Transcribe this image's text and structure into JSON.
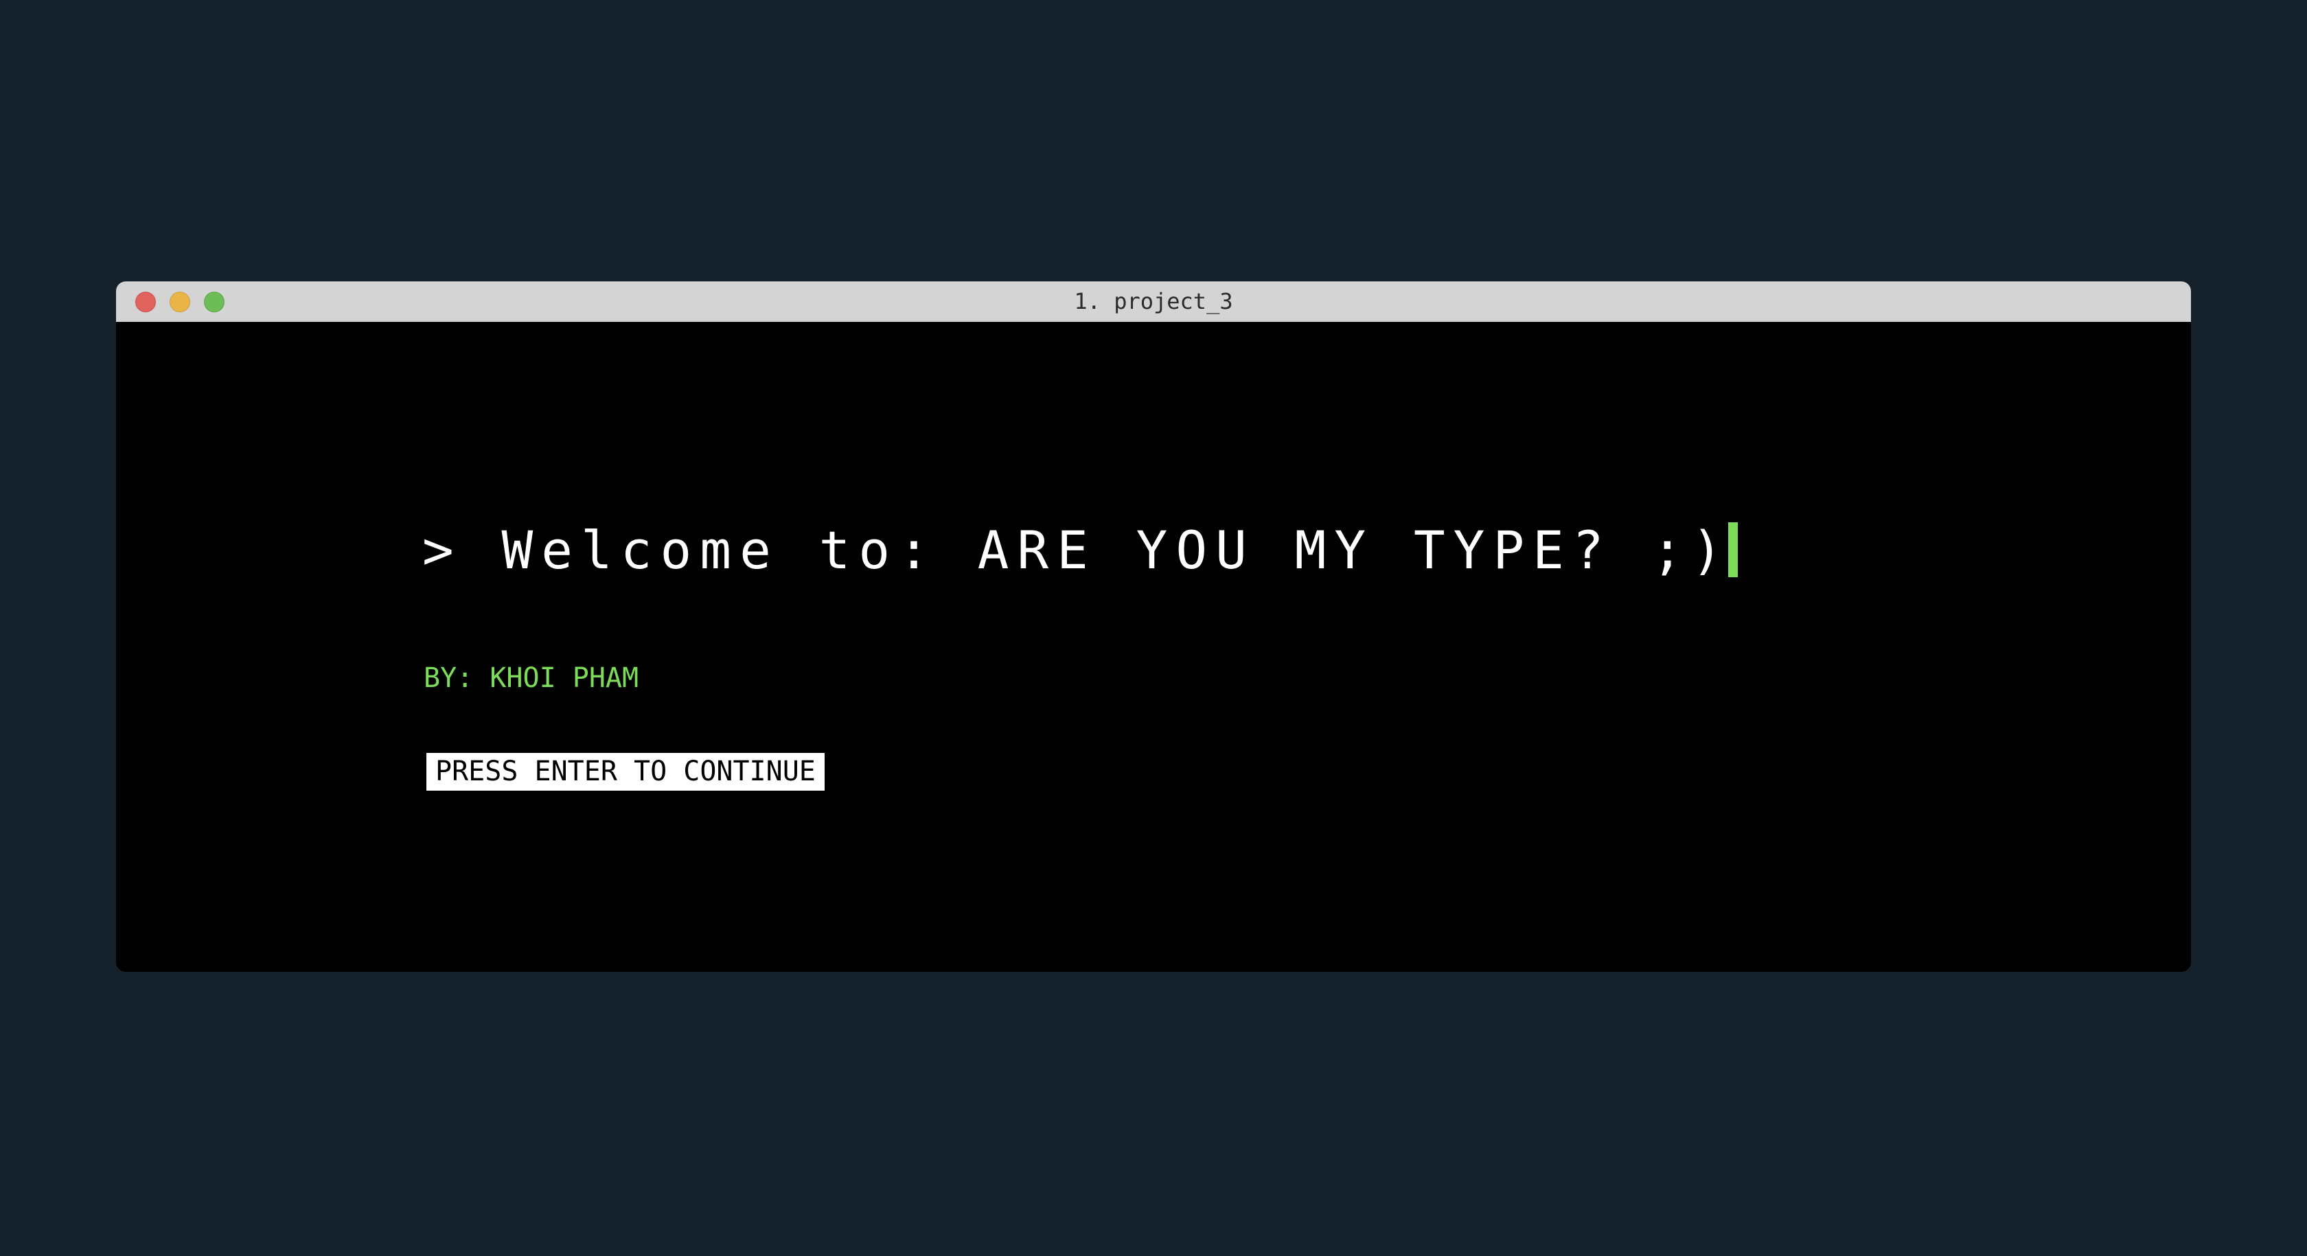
{
  "window": {
    "title": "1. project_3"
  },
  "terminal": {
    "prompt_symbol": ">",
    "welcome_text": "Welcome to: ARE YOU MY TYPE? ;)",
    "author": "BY: KHOI PHAM",
    "continue_prompt": "PRESS ENTER TO CONTINUE"
  },
  "colors": {
    "desktop_background": "#14212a",
    "terminal_background": "#000000",
    "accent_green": "#7cdc5a",
    "title_bar": "#d4d4d4"
  },
  "icons": {
    "close": "close-icon",
    "minimize": "minimize-icon",
    "zoom": "zoom-icon"
  }
}
